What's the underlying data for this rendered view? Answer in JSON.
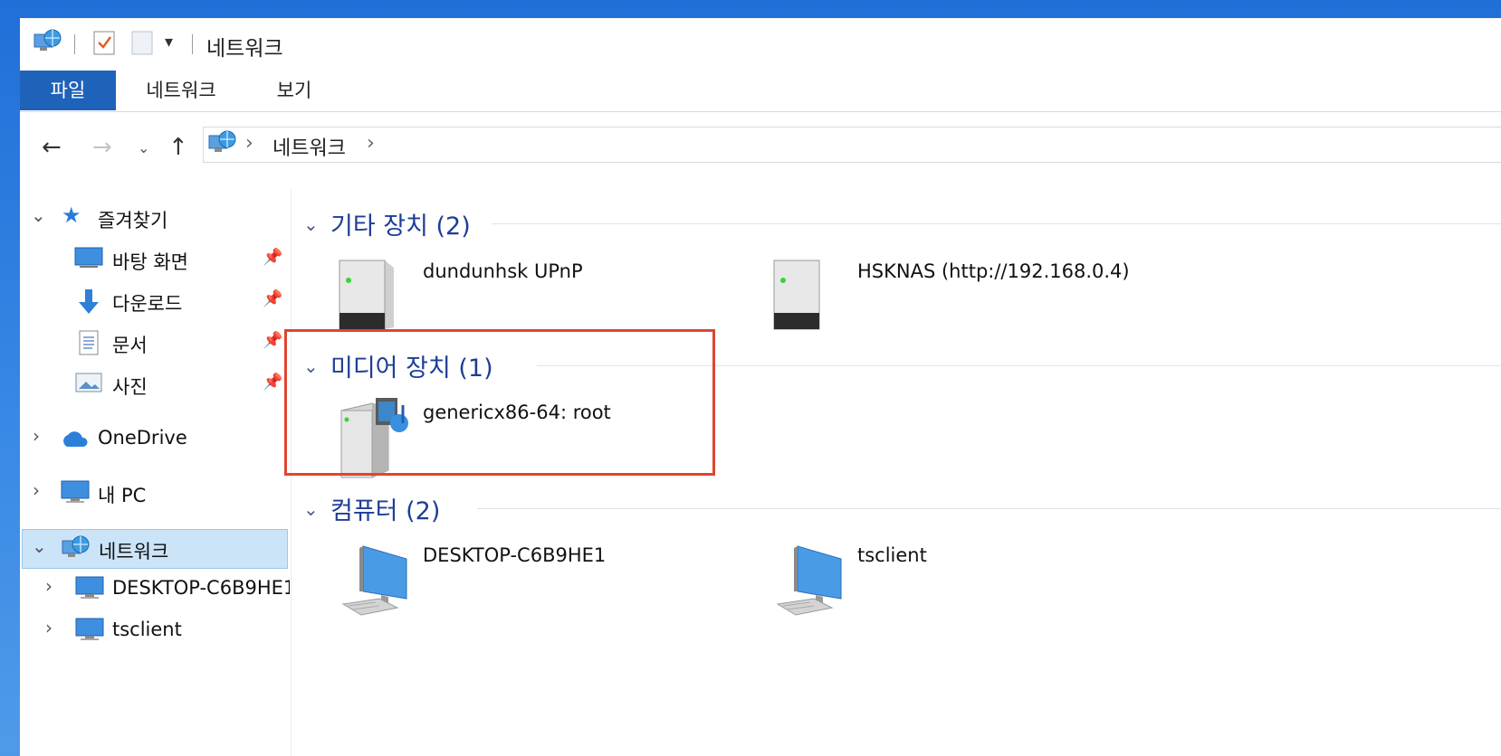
{
  "window": {
    "title": "네트워크"
  },
  "ribbon": {
    "tabs": [
      "파일",
      "네트워크",
      "보기"
    ]
  },
  "address": {
    "crumbs": [
      "네트워크"
    ]
  },
  "sidebar": {
    "quick_access": "즐겨찾기",
    "pinned": [
      "바탕 화면",
      "다운로드",
      "문서",
      "사진"
    ],
    "onedrive": "OneDrive",
    "this_pc": "내 PC",
    "network": "네트워크",
    "network_children": [
      "DESKTOP-C6B9HE1",
      "tsclient"
    ]
  },
  "groups": [
    {
      "title": "기타 장치 (2)",
      "items": [
        "dundunhsk UPnP",
        "HSKNAS  (http://192.168.0.4)"
      ]
    },
    {
      "title": "미디어 장치 (1)",
      "items": [
        "genericx86-64: root"
      ]
    },
    {
      "title": "컴퓨터 (2)",
      "items": [
        "DESKTOP-C6B9HE1",
        "tsclient"
      ]
    }
  ],
  "colors": {
    "accent": "#1e62ba",
    "group_title": "#1e3e96",
    "selection": "#cce4f7",
    "highlight_box": "#e0452f"
  }
}
